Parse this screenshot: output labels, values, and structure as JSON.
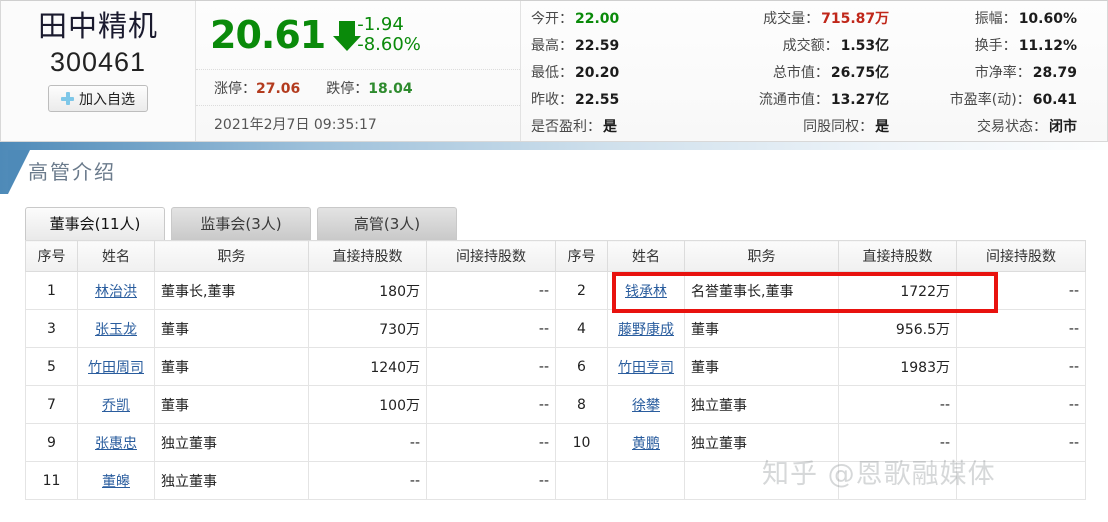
{
  "quote": {
    "stock_name": "田中精机",
    "stock_code": "300461",
    "add_favorite_label": "加入自选",
    "last_price": "20.61",
    "change_amount": "-1.94",
    "change_percent": "-8.60%",
    "direction": "down",
    "limit_up_label": "涨停：",
    "limit_up_value": "27.06",
    "limit_down_label": "跌停：",
    "limit_down_value": "18.04",
    "timestamp": "2021年2月7日 09:35:17",
    "colors": {
      "down_green": "#0a8a0a",
      "up_red": "#c0271a",
      "highlight_red": "#e8120e",
      "accent_blue": "#4e8ab8"
    },
    "stats": [
      {
        "key": "今开：",
        "value": "22.00",
        "color": "green",
        "align": "left"
      },
      {
        "key": "成交量：",
        "value": "715.87万",
        "color": "red",
        "align": "right"
      },
      {
        "key": "振幅：",
        "value": "10.60%",
        "color": "normal",
        "align": "right2"
      },
      {
        "key": "最高：",
        "value": "22.59",
        "color": "normal",
        "align": "left"
      },
      {
        "key": "成交额：",
        "value": "1.53亿",
        "color": "normal",
        "align": "right"
      },
      {
        "key": "换手：",
        "value": "11.12%",
        "color": "normal",
        "align": "right2"
      },
      {
        "key": "最低：",
        "value": "20.20",
        "color": "normal",
        "align": "left"
      },
      {
        "key": "总市值：",
        "value": "26.75亿",
        "color": "normal",
        "align": "right"
      },
      {
        "key": "市净率：",
        "value": "28.79",
        "color": "normal",
        "align": "right2"
      },
      {
        "key": "昨收：",
        "value": "22.55",
        "color": "normal",
        "align": "left"
      },
      {
        "key": "流通市值：",
        "value": "13.27亿",
        "color": "normal",
        "align": "right"
      },
      {
        "key": "市盈率(动)：",
        "value": "60.41",
        "color": "normal",
        "align": "right2"
      },
      {
        "key": "是否盈利：",
        "value": "是",
        "color": "normal",
        "align": "left"
      },
      {
        "key": "同股同权：",
        "value": "是",
        "color": "normal",
        "align": "right"
      },
      {
        "key": "交易状态：",
        "value": "闭市",
        "color": "normal",
        "align": "right2"
      }
    ]
  },
  "section": {
    "title": "高管介绍"
  },
  "tabs": [
    {
      "label": "董事会(11人)",
      "active": true
    },
    {
      "label": "监事会(3人)",
      "active": false
    },
    {
      "label": "高管(3人)",
      "active": false
    }
  ],
  "table": {
    "headers": [
      "序号",
      "姓名",
      "职务",
      "直接持股数",
      "间接持股数",
      "序号",
      "姓名",
      "职务",
      "直接持股数",
      "间接持股数"
    ],
    "rows": [
      {
        "left": {
          "index": "1",
          "name": "林治洪",
          "duty": "董事长,董事",
          "direct": "180万",
          "indirect": "--"
        },
        "right": {
          "index": "2",
          "name": "钱承林",
          "duty": "名誉董事长,董事",
          "direct": "1722万",
          "indirect": "--",
          "highlight": true
        }
      },
      {
        "left": {
          "index": "3",
          "name": "张玉龙",
          "duty": "董事",
          "direct": "730万",
          "indirect": "--"
        },
        "right": {
          "index": "4",
          "name": "藤野康成",
          "duty": "董事",
          "direct": "956.5万",
          "indirect": "--"
        }
      },
      {
        "left": {
          "index": "5",
          "name": "竹田周司",
          "duty": "董事",
          "direct": "1240万",
          "indirect": "--"
        },
        "right": {
          "index": "6",
          "name": "竹田亨司",
          "duty": "董事",
          "direct": "1983万",
          "indirect": "--"
        }
      },
      {
        "left": {
          "index": "7",
          "name": "乔凯",
          "duty": "董事",
          "direct": "100万",
          "indirect": "--"
        },
        "right": {
          "index": "8",
          "name": "徐攀",
          "duty": "独立董事",
          "direct": "--",
          "indirect": "--"
        }
      },
      {
        "left": {
          "index": "9",
          "name": "张惠忠",
          "duty": "独立董事",
          "direct": "--",
          "indirect": "--"
        },
        "right": {
          "index": "10",
          "name": "黄鹏",
          "duty": "独立董事",
          "direct": "--",
          "indirect": "--"
        }
      },
      {
        "left": {
          "index": "11",
          "name": "董皞",
          "duty": "独立董事",
          "direct": "--",
          "indirect": "--"
        },
        "right": null
      }
    ]
  },
  "watermark": {
    "text": "知乎 @恩歌融媒体"
  }
}
